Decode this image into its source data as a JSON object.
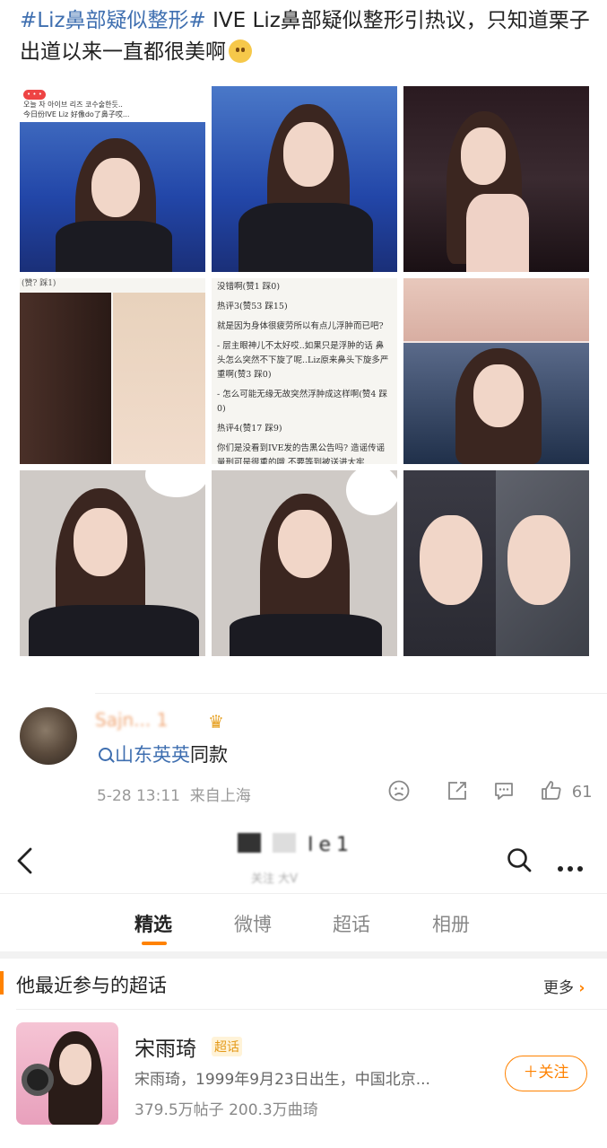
{
  "post": {
    "tag": "#Liz鼻部疑似整形#",
    "body": " IVE Liz鼻部疑似整形引热议，只知道栗子出道以来一直都很美啊"
  },
  "images": {
    "tooltip_line1": "오늘 자 아이브 리즈 코수술한듯..",
    "tooltip_line2": "今日份IVE Liz 好像do了鼻子哎...",
    "doc_lines": [
      "没错啊(赞1 踩0)",
      "热评3(赞53 踩15)",
      "就是因为身体很疲劳所以有点儿浮肿而已吧?",
      "- 层主眼神儿不太好哎..如果只是浮肿的话 鼻头怎么突然不下旋了呢..Liz原来鼻头下旋多严重啊(赞3 踩0)",
      "- 怎么可能无缘无故突然浮肿成这样啊(赞4 踩0)",
      "热评4(赞17 踩9)",
      "你们是没看到IVE发的告黑公告吗? 造谣传谣量刑可是很重的哦 不要等到被送进大牢"
    ],
    "cell4_caption": "(赞? 踩1)"
  },
  "comment": {
    "name": "Sajn...  1",
    "topic_name": "山东英英",
    "topic_suffix": "同款",
    "time": "5-28 13:11",
    "source": "来自上海",
    "likes": "61"
  },
  "navbar": {
    "title": "Ie1",
    "subtitle": "关注 大V"
  },
  "tabs": [
    "精选",
    "微博",
    "超话",
    "相册"
  ],
  "section": {
    "title": "他最近参与的超话",
    "more": "更多"
  },
  "topic_card": {
    "name": "宋雨琦",
    "badge": "超话",
    "desc": "宋雨琦，1999年9月23日出生，中国北京...",
    "stats": "379.5万帖子 200.3万曲琦",
    "follow": "＋关注"
  },
  "colors": {
    "accent": "#ff8200",
    "link": "#3f6fb0"
  }
}
